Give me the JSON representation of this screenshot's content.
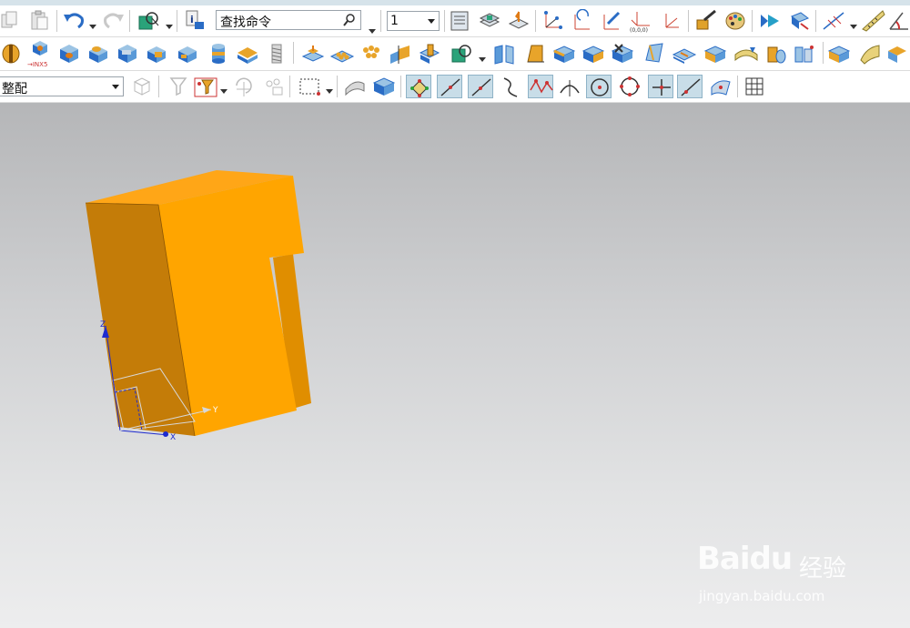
{
  "toolbar1": {
    "search_text": "查找命令",
    "layer_value": "1"
  },
  "toolbar2": {
    "import_label": "→INX5"
  },
  "toolbar3": {
    "filter_value": "整配"
  },
  "viewport": {
    "axis_labels": {
      "x": "X",
      "y": "Y",
      "z": "Z"
    },
    "model_colors": {
      "front": "#ffa500",
      "top": "#ffa617",
      "left": "#c47c08",
      "inner": "#e08e00"
    }
  },
  "watermark": {
    "brand": "Baidu",
    "cn": "经验",
    "url": "jingyan.baidu.com"
  }
}
